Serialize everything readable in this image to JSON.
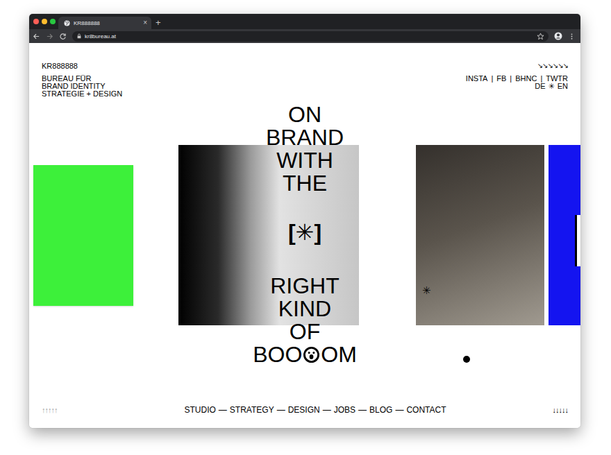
{
  "browser": {
    "tab": {
      "title": "KR888888",
      "close": "×",
      "selected": true
    },
    "new_tab": "+",
    "address": "kr8bureau.at"
  },
  "site": {
    "logo": "KR888888",
    "tagline": [
      "BUREAU FÜR",
      "BRAND IDENTITY",
      "STRATEGIE + DESIGN"
    ],
    "scroll_hint": "↘↘↘↘↘↘",
    "social": {
      "items": [
        "INSTA",
        "FB",
        "BHNC",
        "TWTR"
      ],
      "separator": "|"
    },
    "languages": {
      "items": [
        "DE",
        "EN"
      ],
      "separator": "✳"
    }
  },
  "projects": [
    {
      "kind": "poster",
      "color": "#3df03a"
    },
    {
      "kind": "gradient",
      "color": "#000000"
    },
    {
      "kind": "photo",
      "color": "#5a544c"
    },
    {
      "kind": "block",
      "color": "#1414f0"
    }
  ],
  "headline": {
    "top": [
      "ON",
      "BRAND",
      "WITH",
      "THE"
    ],
    "symbol": "[✳]",
    "bottom": [
      "RIGHT",
      "KIND",
      "OF"
    ],
    "last": {
      "before": "BOO",
      "after": "OM"
    }
  },
  "marker": "✳",
  "footer": {
    "up": "↑↑↑↑↑",
    "nav": [
      "STUDIO",
      "STRATEGY",
      "DESIGN",
      "JOBS",
      "BLOG",
      "CONTACT"
    ],
    "nav_separator": "—",
    "down": "↓↓↓↓↓"
  }
}
